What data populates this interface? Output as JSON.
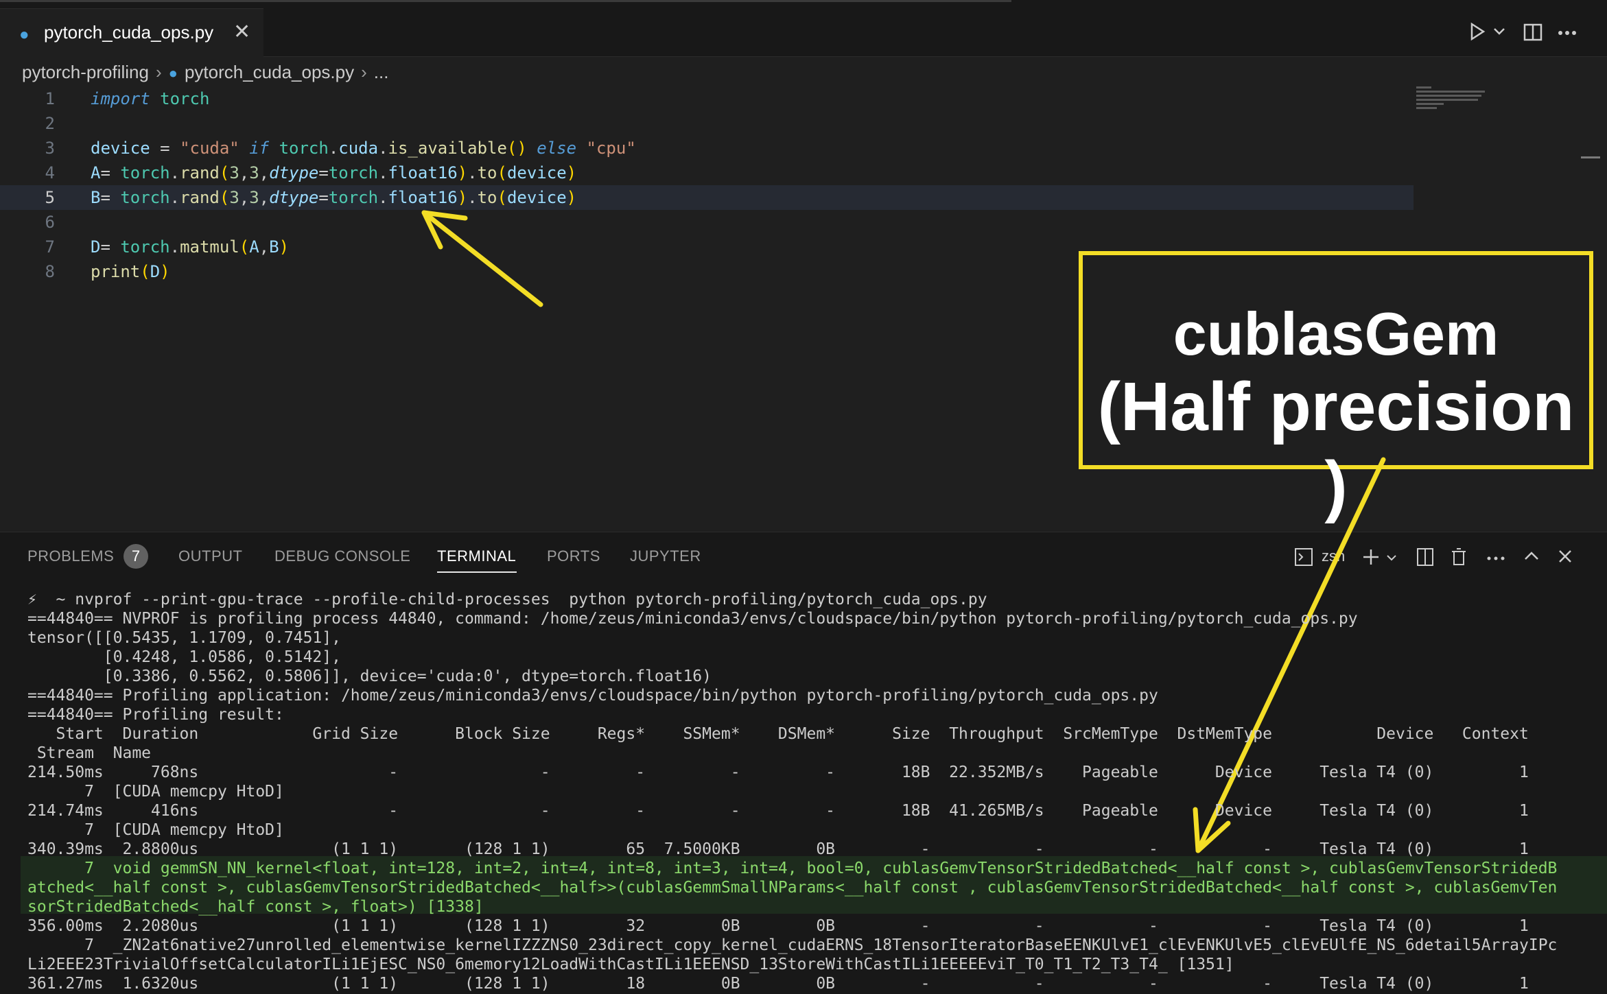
{
  "tabbar": {
    "file_tab": "pytorch_cuda_ops.py",
    "close_glyph": "✕"
  },
  "breadcrumb": {
    "folder": "pytorch-profiling",
    "file": "pytorch_cuda_ops.py",
    "more": "..."
  },
  "editor": {
    "line_numbers": [
      "1",
      "2",
      "3",
      "4",
      "5",
      "6",
      "7",
      "8"
    ]
  },
  "panel": {
    "tabs": [
      "PROBLEMS",
      "OUTPUT",
      "DEBUG CONSOLE",
      "TERMINAL",
      "PORTS",
      "JUPYTER"
    ],
    "active_tab": "TERMINAL",
    "problems_count": "7",
    "shell_label": "zsh"
  },
  "terminal": {
    "lines": [
      "⚡  ~ nvprof --print-gpu-trace --profile-child-processes  python pytorch-profiling/pytorch_cuda_ops.py",
      "==44840== NVPROF is profiling process 44840, command: /home/zeus/miniconda3/envs/cloudspace/bin/python pytorch-profiling/pytorch_cuda_ops.py",
      "tensor([[0.5435, 1.1709, 0.7451],",
      "        [0.4248, 1.0586, 0.5142],",
      "        [0.3386, 0.5562, 0.5806]], device='cuda:0', dtype=torch.float16)",
      "==44840== Profiling application: /home/zeus/miniconda3/envs/cloudspace/bin/python pytorch-profiling/pytorch_cuda_ops.py",
      "==44840== Profiling result:",
      "   Start  Duration            Grid Size      Block Size     Regs*    SSMem*    DSMem*      Size  Throughput  SrcMemType  DstMemType           Device   Context",
      " Stream  Name",
      "214.50ms     768ns                    -               -         -         -         -       18B  22.352MB/s    Pageable      Device     Tesla T4 (0)         1",
      "      7  [CUDA memcpy HtoD]",
      "214.74ms     416ns                    -               -         -         -         -       18B  41.265MB/s    Pageable      Device     Tesla T4 (0)         1",
      "      7  [CUDA memcpy HtoD]",
      "340.39ms  2.8800us              (1 1 1)       (128 1 1)        65  7.5000KB        0B         -           -           -           -     Tesla T4 (0)         1",
      "      7  void gemmSN_NN_kernel<float, int=128, int=2, int=4, int=8, int=3, int=4, bool=0, cublasGemvTensorStridedBatched<__half const >, cublasGemvTensorStridedB",
      "atched<__half const >, cublasGemvTensorStridedBatched<__half>>(cublasGemmSmallNParams<__half const , cublasGemvTensorStridedBatched<__half const >, cublasGemvTen",
      "sorStridedBatched<__half const >, float>) [1338]",
      "356.00ms  2.2080us              (1 1 1)       (128 1 1)        32        0B        0B         -           -           -           -     Tesla T4 (0)         1",
      "      7  _ZN2at6native27unrolled_elementwise_kernelIZZZNS0_23direct_copy_kernel_cudaERNS_18TensorIteratorBaseEENKUlvE1_clEvENKUlvE5_clEvEUlfE_NS_6detail5ArrayIPc",
      "Li2EEE23TrivialOffsetCalculatorILi1EjESC_NS0_6memory12LoadWithCastILi1EEENSD_13StoreWithCastILi1EEEEEviT_T0_T1_T2_T3_T4_ [1351]",
      "361.27ms  1.6320us              (1 1 1)       (128 1 1)        18        0B        0B         -           -           -           -     Tesla T4 (0)         1"
    ],
    "highlighted_lines": [
      14,
      15,
      16
    ]
  },
  "callout": {
    "line1": "cublasGem",
    "line2": "(Half precision )",
    "border_color": "#f3dd26"
  },
  "colors": {
    "background": "#1f1f1f",
    "annotation": "#f3dd26",
    "kernel_text": "#8bd96b"
  }
}
